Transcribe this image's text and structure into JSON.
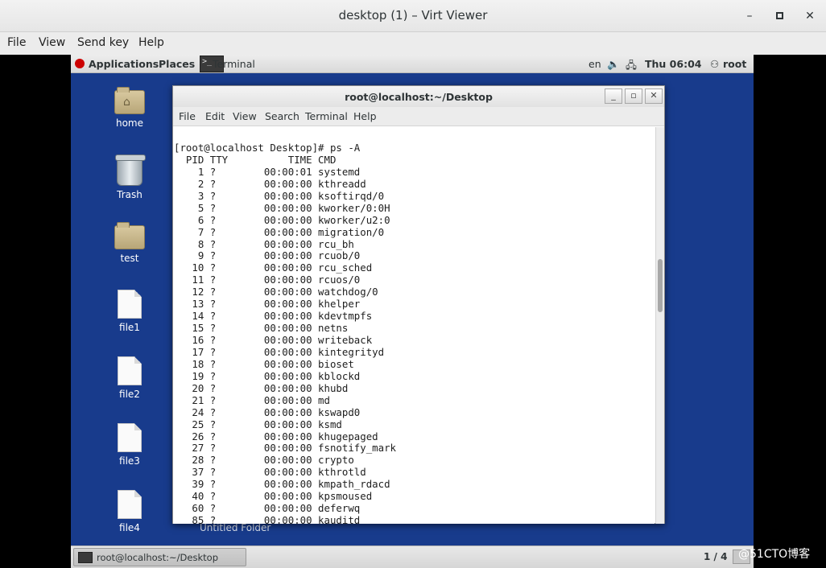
{
  "window": {
    "title": "desktop (1) – Virt Viewer",
    "minimize": "–",
    "maximize": "▫",
    "close": "✕"
  },
  "menubar": [
    "File",
    "View",
    "Send key",
    "Help"
  ],
  "guest_top_panel": {
    "applications": "Applications",
    "places": "Places",
    "terminal_task": "Terminal",
    "language": "en",
    "volume_icon": "speaker-icon",
    "network_icon": "network-icon",
    "clock": "Thu 06:04",
    "user": "root"
  },
  "desktop_icons": [
    {
      "label": "home",
      "icon": "home-folder-icon"
    },
    {
      "label": "Trash",
      "icon": "trash-icon"
    },
    {
      "label": "test",
      "icon": "folder-icon"
    },
    {
      "label": "file1",
      "icon": "file-icon"
    },
    {
      "label": "file2",
      "icon": "file-icon"
    },
    {
      "label": "file3",
      "icon": "file-icon"
    },
    {
      "label": "file4",
      "icon": "file-icon"
    }
  ],
  "untitled_folder": "Untitled Folder",
  "terminal": {
    "title": "root@localhost:~/Desktop",
    "menu": [
      "File",
      "Edit",
      "View",
      "Search",
      "Terminal",
      "Help"
    ],
    "lines": [
      "[root@localhost Desktop]# ps -A",
      "  PID TTY          TIME CMD",
      "    1 ?        00:00:01 systemd",
      "    2 ?        00:00:00 kthreadd",
      "    3 ?        00:00:00 ksoftirqd/0",
      "    5 ?        00:00:00 kworker/0:0H",
      "    6 ?        00:00:00 kworker/u2:0",
      "    7 ?        00:00:00 migration/0",
      "    8 ?        00:00:00 rcu_bh",
      "    9 ?        00:00:00 rcuob/0",
      "   10 ?        00:00:00 rcu_sched",
      "   11 ?        00:00:00 rcuos/0",
      "   12 ?        00:00:00 watchdog/0",
      "   13 ?        00:00:00 khelper",
      "   14 ?        00:00:00 kdevtmpfs",
      "   15 ?        00:00:00 netns",
      "   16 ?        00:00:00 writeback",
      "   17 ?        00:00:00 kintegrityd",
      "   18 ?        00:00:00 bioset",
      "   19 ?        00:00:00 kblockd",
      "   20 ?        00:00:00 khubd",
      "   21 ?        00:00:00 md",
      "   24 ?        00:00:00 kswapd0",
      "   25 ?        00:00:00 ksmd",
      "   26 ?        00:00:00 khugepaged",
      "   27 ?        00:00:00 fsnotify_mark",
      "   28 ?        00:00:00 crypto",
      "   37 ?        00:00:00 kthrotld",
      "   39 ?        00:00:00 kmpath_rdacd",
      "   40 ?        00:00:00 kpsmoused",
      "   60 ?        00:00:00 deferwq",
      "   85 ?        00:00:00 kauditd"
    ]
  },
  "bottom_panel": {
    "task_label": "root@localhost:~/Desktop",
    "workspace": "1 / 4"
  },
  "watermark": "@51CTO博客"
}
